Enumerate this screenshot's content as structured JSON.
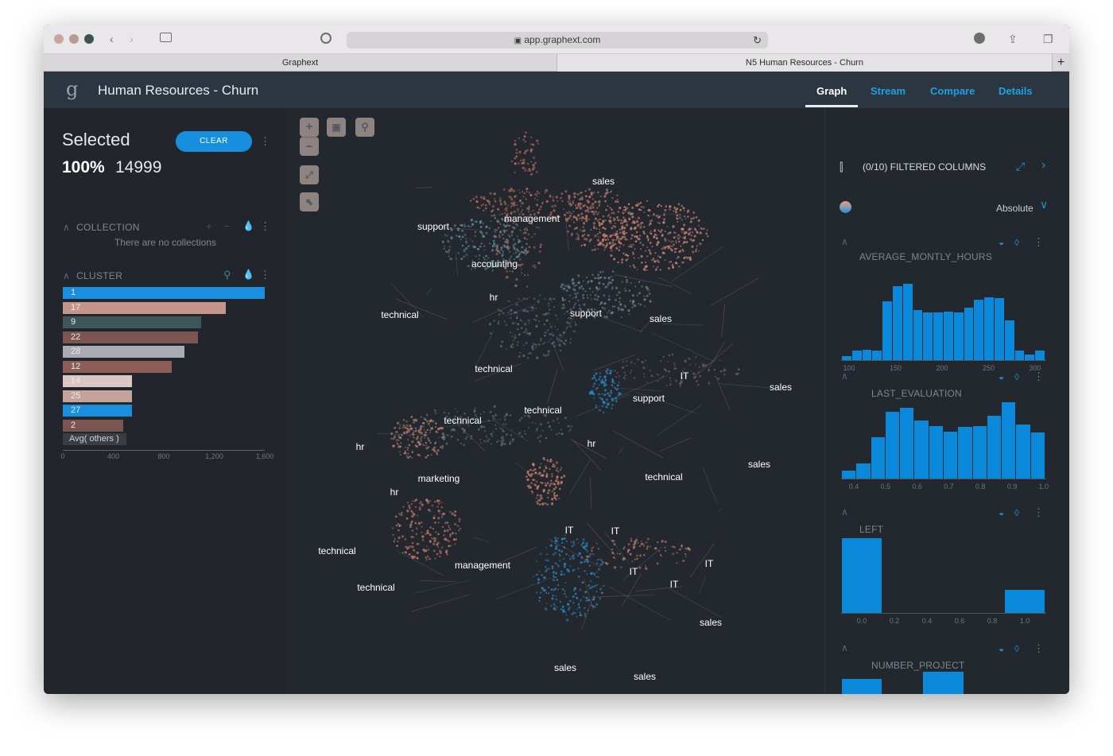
{
  "browser": {
    "url": "app.graphext.com",
    "tabs": [
      "Graphext",
      "N5 Human Resources - Churn"
    ]
  },
  "app": {
    "logo": "g",
    "title": "Human Resources - Churn",
    "nav": [
      {
        "label": "Graph",
        "active": true
      },
      {
        "label": "Stream",
        "active": false
      },
      {
        "label": "Compare",
        "active": false
      },
      {
        "label": "Details",
        "active": false
      }
    ]
  },
  "selection": {
    "label": "Selected",
    "percent": "100%",
    "count": "14999",
    "clear_label": "CLEAR"
  },
  "collection": {
    "title": "COLLECTION",
    "empty_text": "There are no collections"
  },
  "cluster": {
    "title": "CLUSTER",
    "rows": [
      {
        "label": "1",
        "value": 1600,
        "color": "#1a8fde"
      },
      {
        "label": "17",
        "value": 1290,
        "color": "#c4958a"
      },
      {
        "label": "9",
        "value": 1095,
        "color": "#3d5659"
      },
      {
        "label": "22",
        "value": 1070,
        "color": "#7b5550"
      },
      {
        "label": "28",
        "value": 965,
        "color": "#a9aab3"
      },
      {
        "label": "12",
        "value": 865,
        "color": "#8c5e57"
      },
      {
        "label": "14",
        "value": 545,
        "color": "#dcc6c3"
      },
      {
        "label": "25",
        "value": 545,
        "color": "#c4a39c"
      },
      {
        "label": "27",
        "value": 545,
        "color": "#1a8fde"
      },
      {
        "label": "2",
        "value": 480,
        "color": "#7b5550"
      }
    ],
    "avg_label": "Avg( others )",
    "axis_ticks": [
      "0",
      "400",
      "800",
      "1,200",
      "1,600"
    ],
    "axis_max": 1600
  },
  "graph": {
    "labels": [
      {
        "text": "sales"
      },
      {
        "text": "management"
      },
      {
        "text": "support"
      },
      {
        "text": "accounting"
      },
      {
        "text": "hr"
      },
      {
        "text": "technical"
      },
      {
        "text": "support"
      },
      {
        "text": "sales"
      },
      {
        "text": "technical"
      },
      {
        "text": "IT"
      },
      {
        "text": "sales"
      },
      {
        "text": "support"
      },
      {
        "text": "technical"
      },
      {
        "text": "technical"
      },
      {
        "text": "hr"
      },
      {
        "text": "hr"
      },
      {
        "text": "sales"
      },
      {
        "text": "technical"
      },
      {
        "text": "marketing"
      },
      {
        "text": "hr"
      },
      {
        "text": "IT"
      },
      {
        "text": "IT"
      },
      {
        "text": "technical"
      },
      {
        "text": "management"
      },
      {
        "text": "IT"
      },
      {
        "text": "IT"
      },
      {
        "text": "IT"
      },
      {
        "text": "technical"
      },
      {
        "text": "sales"
      },
      {
        "text": "sales"
      },
      {
        "text": "sales"
      }
    ]
  },
  "filters": {
    "title": "(0/10) FILTERED COLUMNS",
    "mode": "Absolute",
    "histograms": [
      {
        "name": "AVERAGE_MONTLY_HOURS",
        "ticks": [
          "100",
          "150",
          "200",
          "250",
          "300"
        ],
        "values": [
          3,
          7,
          8,
          7,
          45,
          56,
          58,
          38,
          36,
          36,
          37,
          36,
          40,
          46,
          48,
          47,
          30,
          7,
          4,
          7
        ]
      },
      {
        "name": "LAST_EVALUATION",
        "ticks": [
          "0.4",
          "0.5",
          "0.6",
          "0.7",
          "0.8",
          "0.9",
          "1.0"
        ],
        "values": [
          6,
          11,
          30,
          48,
          51,
          42,
          38,
          34,
          37,
          38,
          45,
          55,
          39,
          33
        ]
      },
      {
        "name": "LEFT",
        "ticks": [
          "0.0",
          "0.2",
          "0.4",
          "0.6",
          "0.8",
          "1.0"
        ],
        "values": [
          11428,
          0,
          0,
          0,
          3571
        ]
      },
      {
        "name": "NUMBER_PROJECT",
        "ticks": [],
        "values": [
          28,
          0,
          33,
          0,
          4
        ]
      }
    ]
  }
}
